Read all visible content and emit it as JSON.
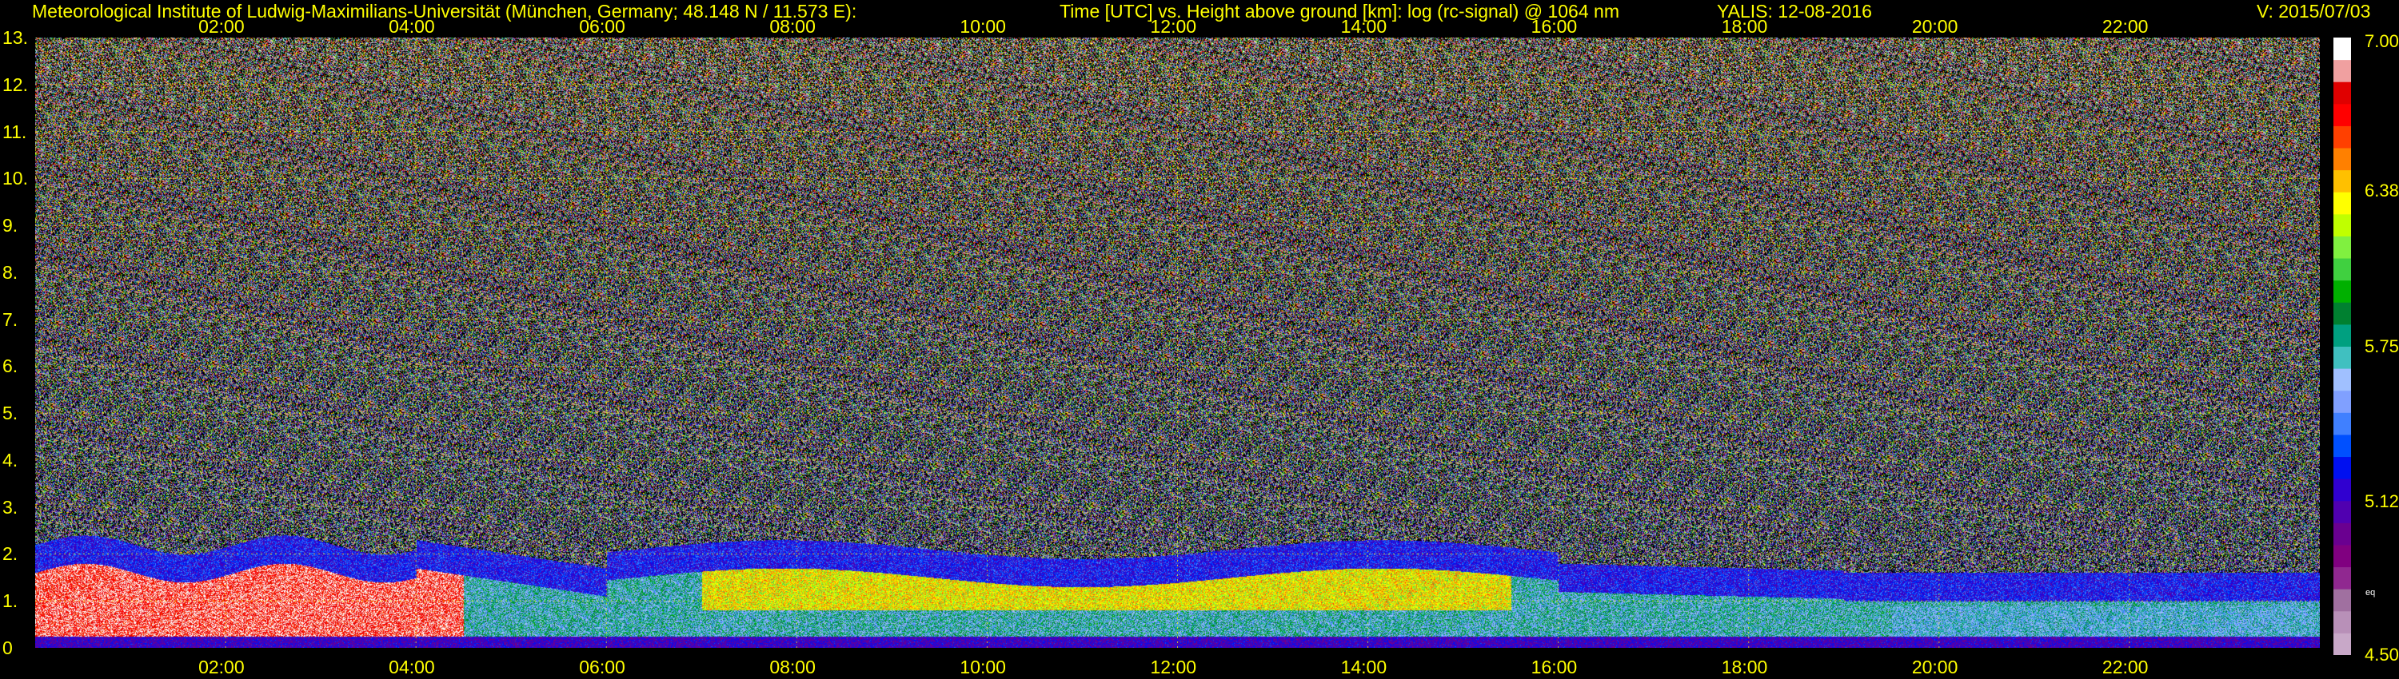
{
  "header": {
    "institute": "Meteorological Institute of Ludwig-Maximilians-Universität (München, Germany; 48.148 N / 11.573 E):",
    "axes_title": "Time [UTC] vs. Height above ground [km]: log (rc-signal) @ 1064 nm",
    "instrument_date": "YALIS: 12-08-2016",
    "version": "V: 2015/07/03"
  },
  "chart_data": {
    "type": "heatmap",
    "xlabel": "Time [UTC]",
    "ylabel": "Height above ground [km]",
    "x_ticks": [
      "02:00",
      "04:00",
      "06:00",
      "08:00",
      "10:00",
      "12:00",
      "14:00",
      "16:00",
      "18:00",
      "20:00",
      "22:00"
    ],
    "x_tick_hours": [
      2,
      4,
      6,
      8,
      10,
      12,
      14,
      16,
      18,
      20,
      22
    ],
    "xlim_hours": [
      0,
      24
    ],
    "y_ticks": [
      "0",
      "1.",
      "2.",
      "3.",
      "4.",
      "5.",
      "6.",
      "7.",
      "8.",
      "9.",
      "10.",
      "11.",
      "12.",
      "13."
    ],
    "ylim_km": [
      0,
      13
    ],
    "grid": true,
    "colorbar": {
      "range": [
        4.5,
        7.0
      ],
      "tick_labels": [
        "7.00",
        "6.38",
        "5.75",
        "5.12",
        "4.50"
      ],
      "tick_values": [
        7.0,
        6.38,
        5.75,
        5.12,
        4.5
      ],
      "extra_label": "eq",
      "colors": [
        "#c8a8c8",
        "#b890b8",
        "#a070a0",
        "#902890",
        "#800080",
        "#6a0090",
        "#5000b0",
        "#3000d0",
        "#0010f0",
        "#0050ff",
        "#4080ff",
        "#80a0ff",
        "#a0c0ff",
        "#40c0c0",
        "#00a080",
        "#008030",
        "#00b000",
        "#40d040",
        "#80f040",
        "#c0ff00",
        "#ffff00",
        "#ffc000",
        "#ff8000",
        "#ff4000",
        "#ff0000",
        "#e00000",
        "#f0a0a0",
        "#ffffff"
      ]
    },
    "color_scale": {
      "background": "#000000",
      "grid": "#ffff00",
      "text": "#ffff00"
    }
  }
}
